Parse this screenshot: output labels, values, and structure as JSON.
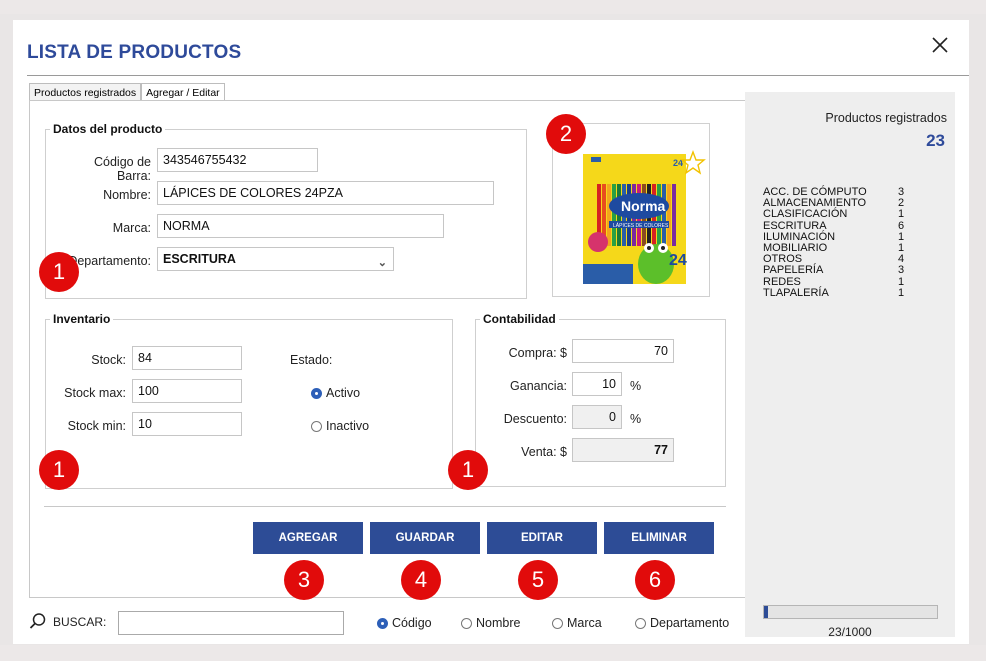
{
  "dialog": {
    "title": "LISTA DE PRODUCTOS",
    "tabs": [
      {
        "label": "Productos registrados",
        "active": false
      },
      {
        "label": "Agregar / Editar",
        "active": true
      }
    ]
  },
  "datos_producto": {
    "group_label": "Datos del producto",
    "codigo_label": "Código de Barra:",
    "codigo_value": "343546755432",
    "nombre_label": "Nombre:",
    "nombre_value": "LÁPICES DE COLORES 24PZA",
    "marca_label": "Marca:",
    "marca_value": "NORMA",
    "departamento_label": "Departamento:",
    "departamento_value": "ESCRITURA"
  },
  "inventario": {
    "group_label": "Inventario",
    "stock_label": "Stock:",
    "stock_value": "84",
    "stock_max_label": "Stock max:",
    "stock_max_value": "100",
    "stock_min_label": "Stock min:",
    "stock_min_value": "10",
    "estado_label": "Estado:",
    "estado_options": [
      {
        "label": "Activo",
        "selected": true
      },
      {
        "label": "Inactivo",
        "selected": false
      }
    ]
  },
  "contabilidad": {
    "group_label": "Contabilidad",
    "compra_label": "Compra: $",
    "compra_value": "70",
    "ganancia_label": "Ganancia:",
    "ganancia_value": "10",
    "ganancia_unit": "%",
    "descuento_label": "Descuento:",
    "descuento_value": "0",
    "descuento_unit": "%",
    "venta_label": "Venta: $",
    "venta_value": "77"
  },
  "buttons": {
    "agregar": "AGREGAR",
    "guardar": "GUARDAR",
    "editar": "EDITAR",
    "eliminar": "ELIMINAR"
  },
  "badges": {
    "b1a": "1",
    "b1b": "1",
    "b1c": "1",
    "b2": "2",
    "b3": "3",
    "b4": "4",
    "b5": "5",
    "b6": "6"
  },
  "product_image": {
    "brand": "Norma",
    "subtitle": "LÁPICES DE COLORES",
    "count": "24"
  },
  "sidebar": {
    "title": "Productos registrados",
    "count": "23",
    "departments": [
      {
        "name": "ACC. DE CÓMPUTO",
        "count": "3"
      },
      {
        "name": "ALMACENAMIENTO",
        "count": "2"
      },
      {
        "name": "CLASIFICACIÓN",
        "count": "1"
      },
      {
        "name": "ESCRITURA",
        "count": "6"
      },
      {
        "name": "ILUMINACIÓN",
        "count": "1"
      },
      {
        "name": "MOBILIARIO",
        "count": "1"
      },
      {
        "name": "OTROS",
        "count": "4"
      },
      {
        "name": "PAPELERÍA",
        "count": "3"
      },
      {
        "name": "REDES",
        "count": "1"
      },
      {
        "name": "TLAPALERÍA",
        "count": "1"
      }
    ],
    "progress_fraction": 0.023,
    "progress_label": "23/1000"
  },
  "search": {
    "label": "BUSCAR:",
    "value": "",
    "options": [
      {
        "label": "Código",
        "selected": true
      },
      {
        "label": "Nombre",
        "selected": false
      },
      {
        "label": "Marca",
        "selected": false
      },
      {
        "label": "Departamento",
        "selected": false
      }
    ]
  },
  "colors": {
    "accent": "#2d4c96",
    "title": "#2e4a9a",
    "badge": "#e10b0b"
  }
}
